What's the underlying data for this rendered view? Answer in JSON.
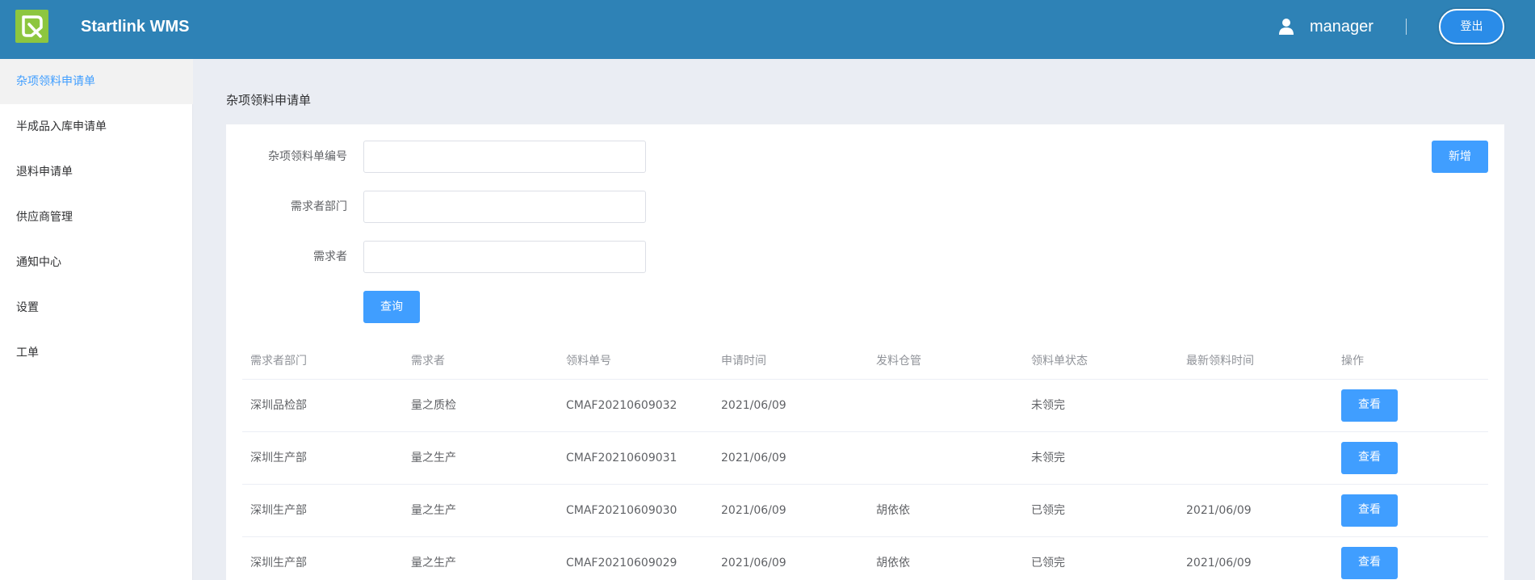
{
  "header": {
    "app_title": "Startlink WMS",
    "user_name": "manager",
    "logout_label": "登出",
    "colors": {
      "bar": "#2e82b6",
      "logo": "#8dc63f"
    }
  },
  "sidebar": {
    "items": [
      {
        "label": "杂项领料申请单",
        "active": true
      },
      {
        "label": "半成品入库申请单"
      },
      {
        "label": "退料申请单"
      },
      {
        "label": "供应商管理"
      },
      {
        "label": "通知中心"
      },
      {
        "label": "设置"
      },
      {
        "label": "工单"
      }
    ]
  },
  "main": {
    "page_title": "杂项领料申请单",
    "add_label": "新增",
    "search_label": "查询",
    "fields": [
      {
        "label": "杂项领料单编号",
        "value": ""
      },
      {
        "label": "需求者部门",
        "value": ""
      },
      {
        "label": "需求者",
        "value": ""
      }
    ]
  },
  "table": {
    "columns": [
      "需求者部门",
      "需求者",
      "领料单号",
      "申请时间",
      "发料仓管",
      "领料单状态",
      "最新领料时间",
      "操作"
    ],
    "action_label": "查看",
    "rows": [
      [
        "深圳品检部",
        "量之质检",
        "CMAF20210609032",
        "2021/06/09",
        "",
        "未领完",
        ""
      ],
      [
        "深圳生产部",
        "量之生产",
        "CMAF20210609031",
        "2021/06/09",
        "",
        "未领完",
        ""
      ],
      [
        "深圳生产部",
        "量之生产",
        "CMAF20210609030",
        "2021/06/09",
        "胡依依",
        "已领完",
        "2021/06/09"
      ],
      [
        "深圳生产部",
        "量之生产",
        "CMAF20210609029",
        "2021/06/09",
        "胡依依",
        "已领完",
        "2021/06/09"
      ]
    ]
  }
}
